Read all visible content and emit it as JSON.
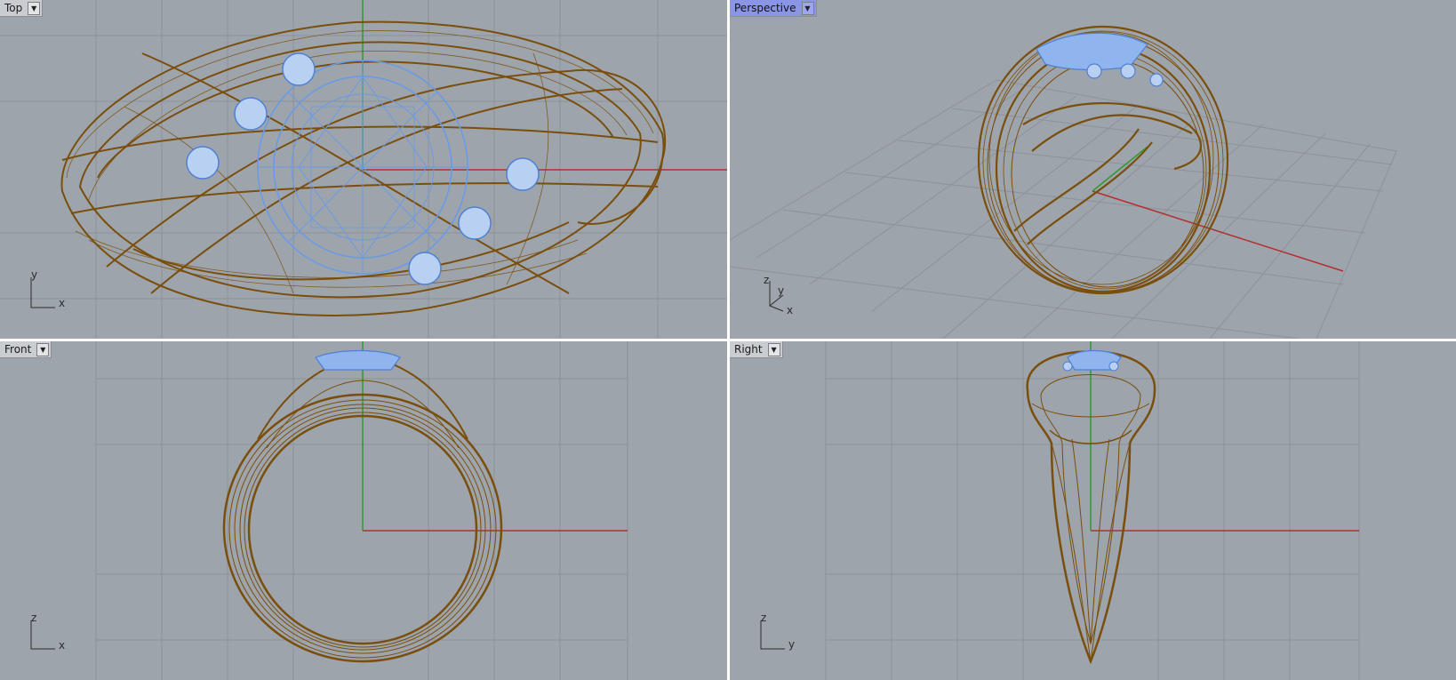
{
  "viewports": {
    "top": {
      "label": "Top",
      "axis_a": "y",
      "axis_b": "x"
    },
    "perspective": {
      "label": "Perspective",
      "axis_a": "z",
      "axis_b": "y",
      "axis_c": "x"
    },
    "front": {
      "label": "Front",
      "axis_a": "z",
      "axis_b": "x"
    },
    "right": {
      "label": "Right",
      "axis_a": "z",
      "axis_b": "y"
    }
  },
  "colors": {
    "viewport_bg": "#9ea4ab",
    "grid_line": "#8d939a",
    "grid_major": "#7c8188",
    "wire_gold": "#7a4e0c",
    "wire_blue": "#6a9ae6",
    "axis_x": "#b03030",
    "axis_y": "#2f9a2f",
    "active_tab": "#8a95e6"
  },
  "icons": {
    "dropdown": "triangle-down-icon"
  }
}
